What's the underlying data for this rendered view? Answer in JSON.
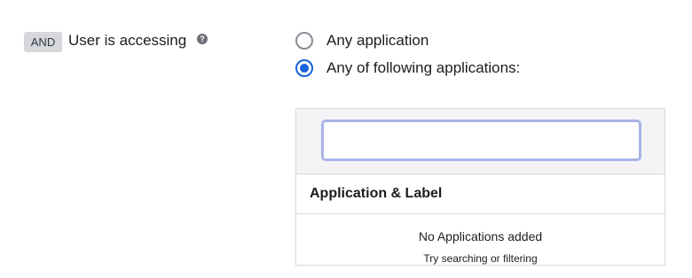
{
  "condition": {
    "operator": "AND",
    "label": "User is accessing",
    "help_icon": "question-circle-icon"
  },
  "options": [
    {
      "label": "Any application",
      "selected": false
    },
    {
      "label": "Any of following applications:",
      "selected": true
    }
  ],
  "app_picker": {
    "search_value": "",
    "column_header": "Application & Label",
    "empty_title": "No Applications added",
    "empty_subtitle": "Try searching or filtering"
  },
  "colors": {
    "accent": "#1662dd",
    "focus_ring": "#a9b3e6",
    "badge_bg": "#d7d7dc"
  }
}
